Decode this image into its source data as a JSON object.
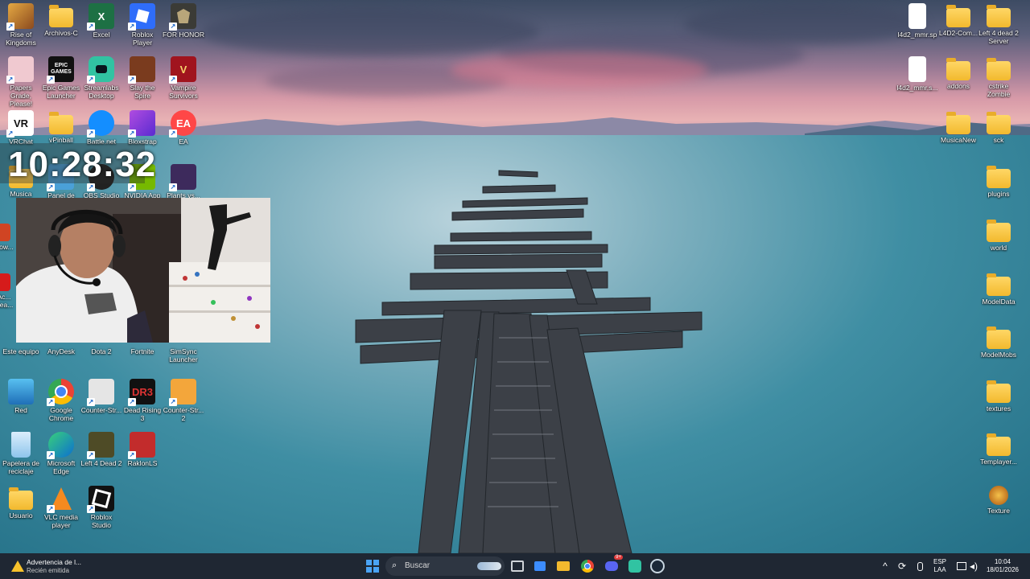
{
  "desktop_left": {
    "row1": [
      "Rise of Kingdoms",
      "Archivos-C",
      "Excel",
      "Roblox Player",
      "FOR HONOR"
    ],
    "row2": [
      "Papers Grade, Please!",
      "Epic Games Launcher",
      "Streamlabs Desktop",
      "Slay the Spire",
      "Vampire Survivors"
    ],
    "row3": [
      "VRChat",
      "vPinball",
      "Battle.net",
      "Bloxstrap",
      "EA"
    ],
    "row4": [
      "Musica",
      "Panel de",
      "OBS Studio",
      "NVIDIA App",
      "Plants vs..."
    ],
    "row5_left": [
      "Pow...",
      "Ac... Rea..."
    ],
    "row7": [
      "Este equipo",
      "AnyDesk",
      "Dota 2",
      "Fortnite",
      "SimSync Launcher"
    ],
    "row8": [
      "Red",
      "Google Chrome",
      "Counter-Str...",
      "Dead Rising 3",
      "Counter-Str... 2"
    ],
    "row9": [
      "Papelera de reciclaje",
      "Microsoft Edge",
      "Left 4 Dead 2",
      "RaklonLS"
    ],
    "row10": [
      "Usuario",
      "VLC media player",
      "Roblox Studio"
    ]
  },
  "desktop_right": {
    "col1": [
      "l4d2_mmr.sp",
      "l4d2_mmr.s...",
      "MusicaNew"
    ],
    "col2": [
      "L4D2-Com...",
      "addons"
    ],
    "col3": [
      "Left 4 dead 2 Server",
      "cstrike Zombie",
      "sck",
      "plugins",
      "world",
      "ModelData",
      "ModelMobs",
      "textures",
      "Templayer...",
      "Texture"
    ]
  },
  "icon_texts": {
    "excel": "X",
    "epic": "EPIC GAMES",
    "vr": "VR",
    "ea": "EA",
    "dr3": "DR3"
  },
  "clock_overlay": "10:28:32",
  "taskbar": {
    "notification_title": "Advertencia de l...",
    "notification_sub": "Recién emitida",
    "search_placeholder": "Buscar",
    "lang_1": "ESP",
    "lang_2": "LAA",
    "time": "10:04",
    "date": "18/01/2026",
    "discord_badge": "9+"
  },
  "colors": {
    "taskbar": "#1f2733",
    "folder": "#f2b92e",
    "accent": "#3c8dff"
  }
}
